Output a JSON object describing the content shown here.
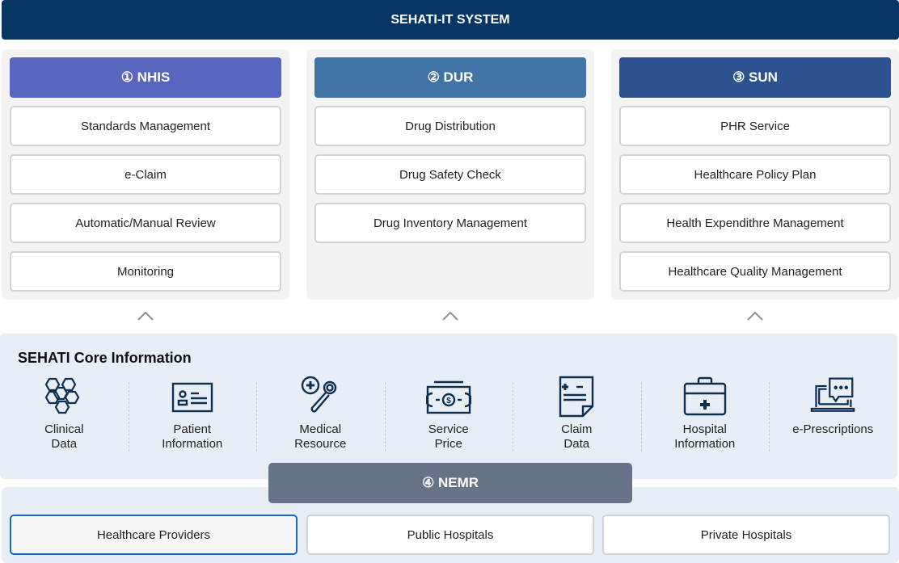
{
  "header": {
    "title": "SEHATI-IT SYSTEM"
  },
  "columns": [
    {
      "title": "① NHIS",
      "color": "#5866bf",
      "items": [
        "Standards Management",
        "e-Claim",
        "Automatic/Manual Review",
        "Monitoring"
      ]
    },
    {
      "title": "② DUR",
      "color": "#4174a6",
      "items": [
        "Drug Distribution",
        "Drug Safety Check",
        "Drug Inventory Management"
      ]
    },
    {
      "title": "③ SUN",
      "color": "#2c528f",
      "items": [
        "PHR Service",
        "Healthcare Policy Plan",
        "Health Expendithre Management",
        "Healthcare Quality Management"
      ]
    }
  ],
  "core": {
    "title": "SEHATI Core Information",
    "items": [
      {
        "label": "Clinical\nData",
        "icon": "hexagon-cluster-icon"
      },
      {
        "label": "Patient\nInformation",
        "icon": "id-card-icon"
      },
      {
        "label": "Medical\nResource",
        "icon": "medical-magnifier-icon"
      },
      {
        "label": "Service\nPrice",
        "icon": "banknote-icon"
      },
      {
        "label": "Claim\nData",
        "icon": "claim-document-icon"
      },
      {
        "label": "Hospital\nInformation",
        "icon": "medical-kit-icon"
      },
      {
        "label": "e-Prescriptions",
        "icon": "laptop-chat-icon"
      }
    ],
    "icon_color": "#0c2f52"
  },
  "nemr": {
    "title": "④ NEMR",
    "items": [
      "Healthcare Providers",
      "Public Hospitals",
      "Private Hospitals"
    ],
    "selected_index": 0
  }
}
